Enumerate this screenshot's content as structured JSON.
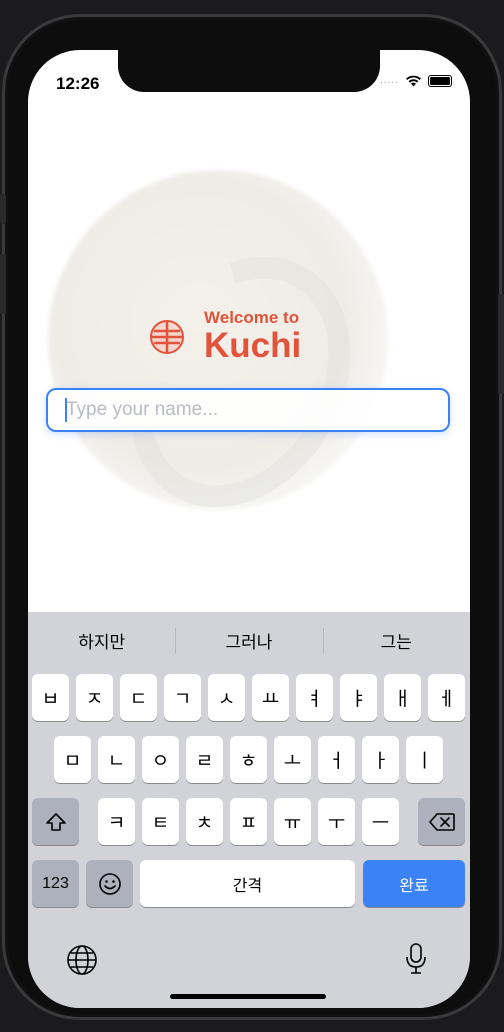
{
  "status_bar": {
    "time": "12:26",
    "signal": "....."
  },
  "welcome": {
    "line1": "Welcome to",
    "line2": "Kuchi"
  },
  "name_input": {
    "placeholder": "Type your name...",
    "value": ""
  },
  "keyboard": {
    "suggestions": [
      "하지만",
      "그러나",
      "그는"
    ],
    "row1": [
      "ㅂ",
      "ㅈ",
      "ㄷ",
      "ㄱ",
      "ㅅ",
      "ㅛ",
      "ㅕ",
      "ㅑ",
      "ㅐ",
      "ㅔ"
    ],
    "row2": [
      "ㅁ",
      "ㄴ",
      "ㅇ",
      "ㄹ",
      "ㅎ",
      "ㅗ",
      "ㅓ",
      "ㅏ",
      "ㅣ"
    ],
    "row3": [
      "ㅋ",
      "ㅌ",
      "ㅊ",
      "ㅍ",
      "ㅠ",
      "ㅜ",
      "ㅡ"
    ],
    "numbers_label": "123",
    "space_label": "간격",
    "done_label": "완료",
    "icons": {
      "shift": "shift-icon",
      "delete": "delete-icon",
      "emoji": "emoji-icon",
      "globe": "globe-icon",
      "mic": "microphone-icon"
    }
  },
  "colors": {
    "accent": "#e2533b",
    "input_border": "#3a82f7",
    "done_key": "#3b82f6",
    "keyboard_bg": "#d1d3d9"
  }
}
